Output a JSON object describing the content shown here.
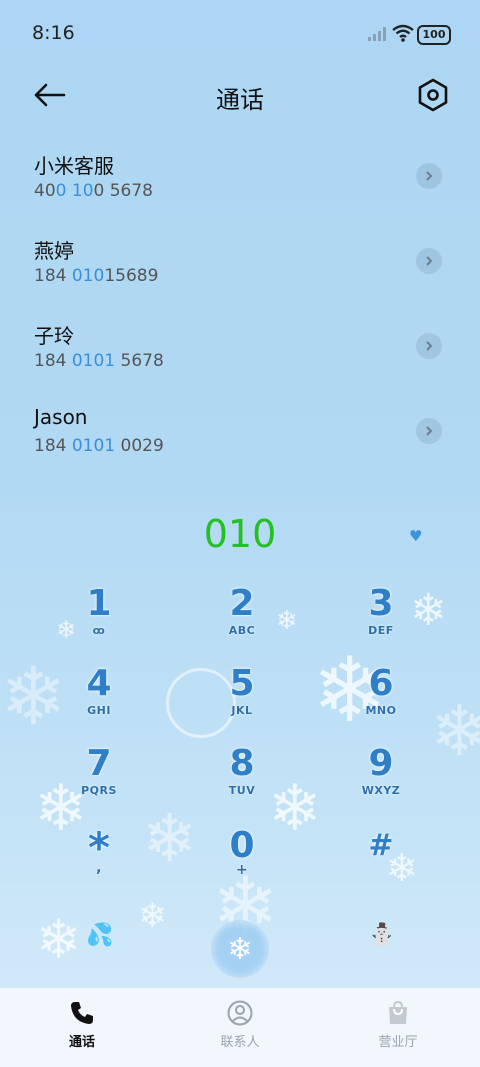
{
  "status_bar": {
    "time": "8:16",
    "battery": "100"
  },
  "header": {
    "title": "通话"
  },
  "contacts": [
    {
      "name": "小米客服",
      "number": {
        "pre": "40",
        "hl1": "0",
        "mid": " ",
        "hl2": "10",
        "post": "0 5678"
      }
    },
    {
      "name": "燕婷",
      "number": {
        "pre": "184 ",
        "hl1": "010",
        "mid": "",
        "hl2": "",
        "post": "15689"
      }
    },
    {
      "name": "子玲",
      "number": {
        "pre": "184 ",
        "hl1": "0101",
        "mid": "",
        "hl2": "",
        "post": " 5678"
      }
    },
    {
      "name": "Jason",
      "number": {
        "pre": "184 ",
        "hl1": "0101",
        "mid": "",
        "hl2": "",
        "post": " 0029"
      }
    }
  ],
  "dialer": {
    "typed_number": "010",
    "keys": [
      {
        "digit": "1",
        "letters": "ꝏ"
      },
      {
        "digit": "2",
        "letters": "ABC"
      },
      {
        "digit": "3",
        "letters": "DEF"
      },
      {
        "digit": "4",
        "letters": "GHI"
      },
      {
        "digit": "5",
        "letters": "JKL"
      },
      {
        "digit": "6",
        "letters": "MNO"
      },
      {
        "digit": "7",
        "letters": "PQRS"
      },
      {
        "digit": "8",
        "letters": "TUV"
      },
      {
        "digit": "9",
        "letters": "WXYZ"
      },
      {
        "digit": "*",
        "letters": ","
      },
      {
        "digit": "0",
        "letters": "+"
      },
      {
        "digit": "#",
        "letters": ""
      }
    ]
  },
  "bottom_nav": [
    {
      "label": "通话",
      "icon": "phone-icon",
      "active": true
    },
    {
      "label": "联系人",
      "icon": "person-icon",
      "active": false
    },
    {
      "label": "营业厅",
      "icon": "shopping-bag-icon",
      "active": false
    }
  ],
  "colors": {
    "highlight": "#3a8fdb",
    "typed_number": "#22c022",
    "key_digit": "#2e7fc7"
  }
}
